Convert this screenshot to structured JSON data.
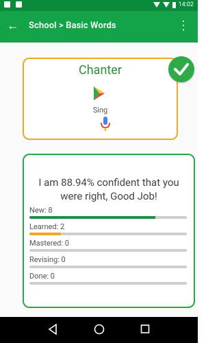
{
  "statusbar": {
    "time": "14:02"
  },
  "appbar": {
    "title": "School > Basic Words"
  },
  "card": {
    "word": "Chanter",
    "translation": "Sing"
  },
  "result": {
    "message": "I am 88.94% confident that you were right, Good Job!"
  },
  "stats": [
    {
      "label": "New: 8",
      "progress": 0.8,
      "color": "#1f8f45"
    },
    {
      "label": "Learned: 2",
      "progress": 0.2,
      "color": "#f1a723"
    },
    {
      "label": "Mastered: 0",
      "progress": 0.0,
      "color": "#1f8f45"
    },
    {
      "label": "Revising: 0",
      "progress": 0.0,
      "color": "#1f8f45"
    },
    {
      "label": "Done: 0",
      "progress": 0.0,
      "color": "#1f8f45"
    }
  ],
  "colors": {
    "primary": "#13a44a",
    "status": "#0a8a3b",
    "accent": "#f1a723",
    "success": "#2faa49"
  }
}
